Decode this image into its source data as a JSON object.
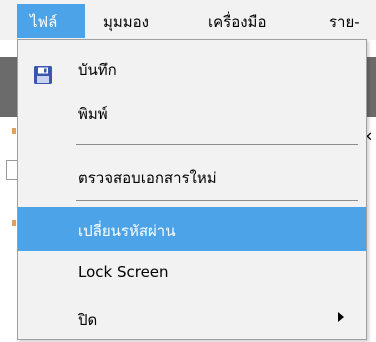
{
  "menubar": {
    "items": [
      {
        "label": "ไฟล์"
      },
      {
        "label": "มุมมอง"
      },
      {
        "label": "เครื่องมือ"
      },
      {
        "label": "ราย-"
      }
    ]
  },
  "file_menu": {
    "items": [
      {
        "label": "บันทึก",
        "icon": "floppy-disk-icon"
      },
      {
        "label": "พิมพ์"
      },
      {
        "label": "ตรวจสอบเอกสารใหม่"
      },
      {
        "label": "เปลี่ยนรหัสผ่าน",
        "highlighted": true
      },
      {
        "label": "Lock Screen"
      },
      {
        "label": "ปิด",
        "submenu": true
      }
    ]
  },
  "colors": {
    "highlight": "#4da3e8",
    "menu_background": "#f2f2f2"
  }
}
